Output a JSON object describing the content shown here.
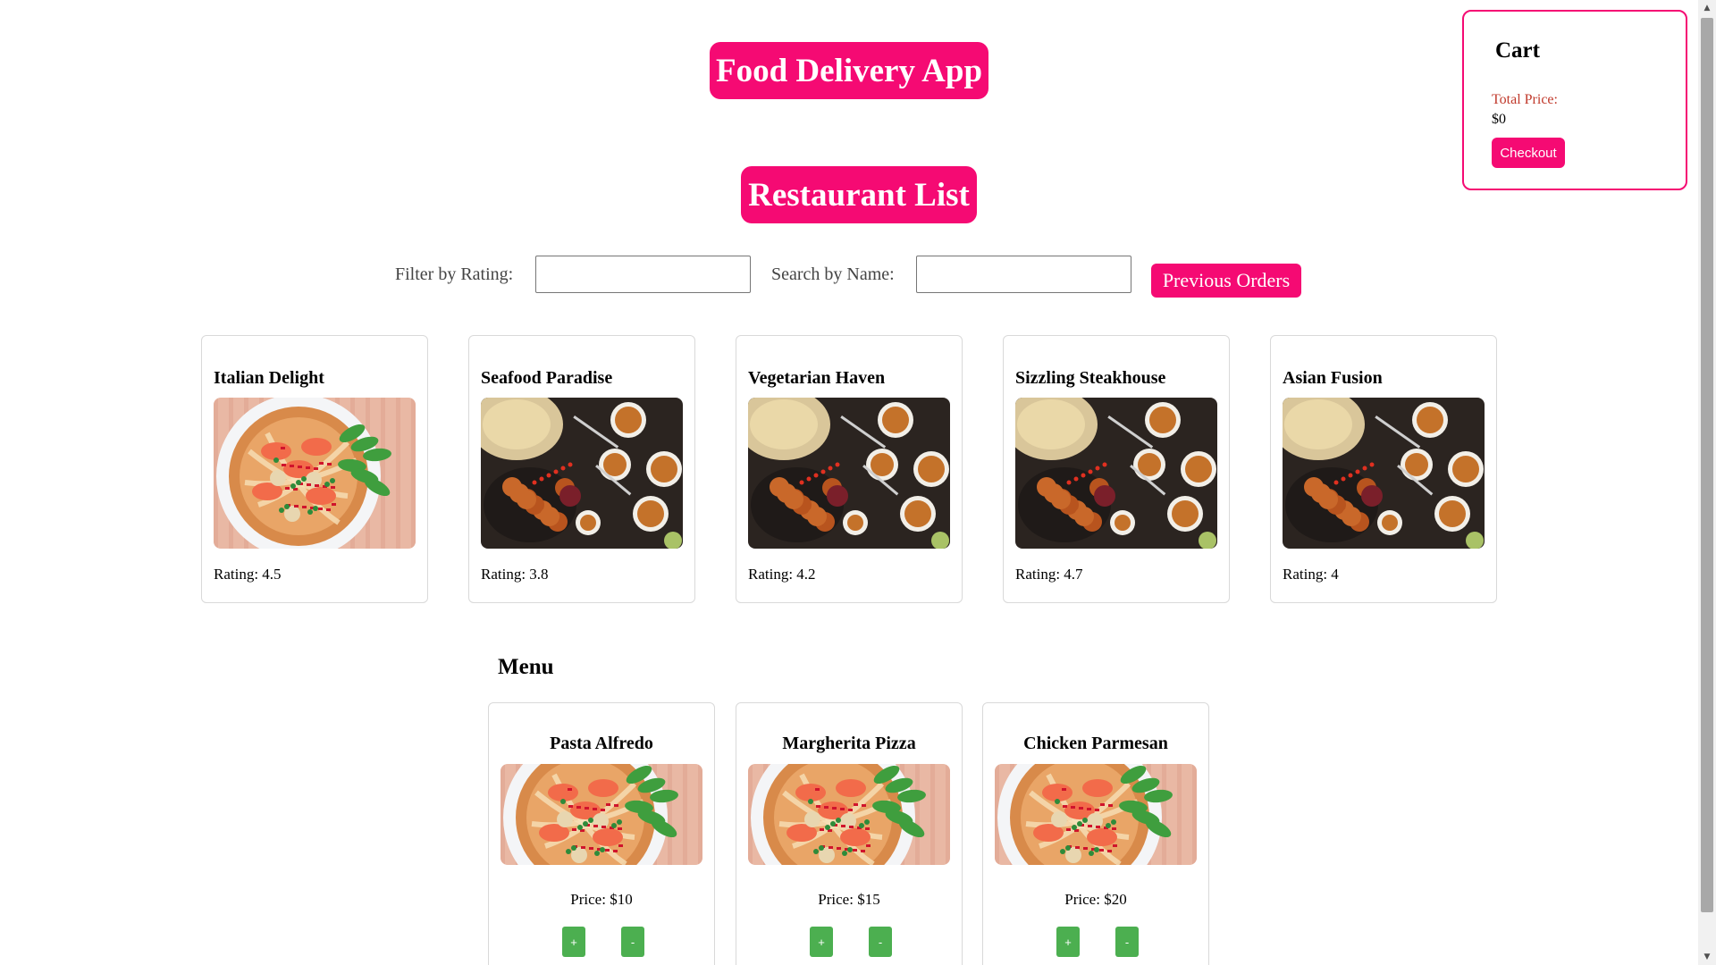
{
  "header": {
    "app_title": "Food Delivery App",
    "section_title": "Restaurant List"
  },
  "filters": {
    "rating_label": "Filter by Rating:",
    "rating_value": "",
    "name_label": "Search by Name:",
    "name_value": "",
    "previous_orders_label": "Previous Orders"
  },
  "restaurants": [
    {
      "name": "Italian Delight",
      "rating_text": "Rating: 4.5",
      "image": "noodle-bowl"
    },
    {
      "name": "Seafood Paradise",
      "rating_text": "Rating: 3.8",
      "image": "food-spread"
    },
    {
      "name": "Vegetarian Haven",
      "rating_text": "Rating: 4.2",
      "image": "food-spread"
    },
    {
      "name": "Sizzling Steakhouse",
      "rating_text": "Rating: 4.7",
      "image": "food-spread"
    },
    {
      "name": "Asian Fusion",
      "rating_text": "Rating: 4",
      "image": "food-spread"
    }
  ],
  "menu": {
    "heading": "Menu",
    "items": [
      {
        "name": "Pasta Alfredo",
        "price_text": "Price: $10",
        "add_label": "+",
        "remove_label": "-",
        "image": "noodle-bowl"
      },
      {
        "name": "Margherita Pizza",
        "price_text": "Price: $15",
        "add_label": "+",
        "remove_label": "-",
        "image": "noodle-bowl"
      },
      {
        "name": "Chicken Parmesan",
        "price_text": "Price: $20",
        "add_label": "+",
        "remove_label": "-",
        "image": "noodle-bowl"
      }
    ]
  },
  "cart": {
    "title": "Cart",
    "total_label": "Total Price:",
    "total_value": "$0",
    "checkout_label": "Checkout"
  },
  "scrollbar": {
    "up_icon": "triangle-up-icon",
    "down_icon": "triangle-down-icon"
  },
  "colors": {
    "accent": "#f50a73",
    "qty_button": "#4caf50",
    "total_label": "#c0392b"
  }
}
